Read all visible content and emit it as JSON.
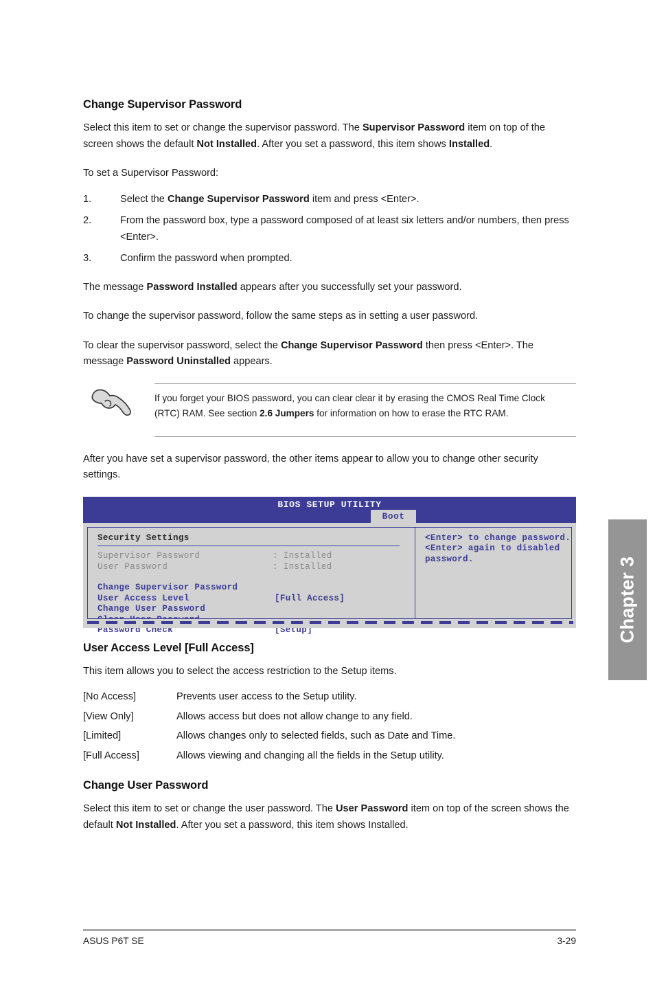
{
  "page": {
    "chapter_tab": "Chapter 3",
    "footer_left": "ASUS P6T SE",
    "footer_right": "3-29"
  },
  "sections": {
    "change_supervisor_password": {
      "heading": "Change Supervisor Password",
      "intro_part1": "Select this item to set or change the supervisor password. The ",
      "intro_bold1": "Supervisor Password",
      "intro_part2": " item on top of the screen shows the default ",
      "intro_bold2": "Not Installed",
      "intro_part3": ". After you set a password, this item shows ",
      "intro_bold3": "Installed",
      "intro_part4": ".",
      "steps_lead": "To set a Supervisor Password:",
      "steps": [
        {
          "number": "1.",
          "text_part1": "Select the ",
          "bold": "Change Supervisor Password",
          "text_part2": " item and press <Enter>."
        },
        {
          "number": "2.",
          "text_part1": "From the password box, type a password composed of at least six letters and/or numbers, then press <Enter>.",
          "bold": "",
          "text_part2": ""
        },
        {
          "number": "3.",
          "text_part1": "Confirm the password when prompted.",
          "bold": "",
          "text_part2": ""
        }
      ],
      "after_steps_p1_part1": "The message ",
      "after_steps_p1_bold": "Password Installed",
      "after_steps_p1_part2": " appears after you successfully set your password.",
      "after_steps_p2": "To change the supervisor password, follow the same steps as in setting a user password.",
      "after_steps_p3_part1": "To clear the supervisor password, select the ",
      "after_steps_p3_bold1": "Change Supervisor Password",
      "after_steps_p3_part2": " then press <Enter>. The message ",
      "after_steps_p3_bold2": "Password Uninstalled",
      "after_steps_p3_part3": " appears."
    },
    "note": {
      "icon": "pointing-hand-icon",
      "text_part1": "If you forget your BIOS password, you can clear clear it by erasing the CMOS Real Time Clock (RTC) RAM. See section ",
      "bold": "2.6 Jumpers",
      "text_part2": " for information on how to erase the RTC RAM."
    },
    "after_note": "After you have set a supervisor password, the other items appear to allow you to change other security settings.",
    "user_access_level": {
      "heading": "User Access Level [Full Access]",
      "intro": "This item allows you to select the access restriction to the Setup items.",
      "options": [
        {
          "term": "[No Access]",
          "desc": "Prevents user access to the Setup utility."
        },
        {
          "term": "[View Only]",
          "desc": "Allows access but does not allow change to any field."
        },
        {
          "term": "[Limited]",
          "desc": "Allows changes only to selected fields, such as Date and Time."
        },
        {
          "term": "[Full Access]",
          "desc": "Allows viewing and changing all the fields in the Setup utility."
        }
      ]
    },
    "change_user_password": {
      "heading": "Change User Password",
      "text_part1": "Select this item to set or change the user password. The ",
      "bold1": "User Password",
      "text_part2": " item on top of the screen shows the default ",
      "bold2": "Not Installed",
      "text_part3": ". After you set a password, this item shows Installed."
    }
  },
  "bios_screenshot": {
    "title": "BIOS SETUP UTILITY",
    "active_tab": "Boot",
    "panel_heading": "Security Settings",
    "status_rows": [
      {
        "label": "Supervisor Password",
        "separator": ": Installed"
      },
      {
        "label": "User Password",
        "separator": ": Installed"
      }
    ],
    "menu_rows": [
      {
        "label": "Change Supervisor Password",
        "value": ""
      },
      {
        "label": "User Access Level",
        "value": "[Full Access]"
      },
      {
        "label": "Change User Password",
        "value": ""
      },
      {
        "label": "Clear User Password",
        "value": ""
      },
      {
        "label": "Password Check",
        "value": "[Setup]"
      }
    ],
    "help_text": "<Enter> to change password.\n<Enter> again to disabled password.",
    "colors": {
      "header_bar": "#3c3c96",
      "body": "#d2d2d2",
      "accent_text": "#3c3c96",
      "dim_text": "#8a8a8a"
    }
  }
}
